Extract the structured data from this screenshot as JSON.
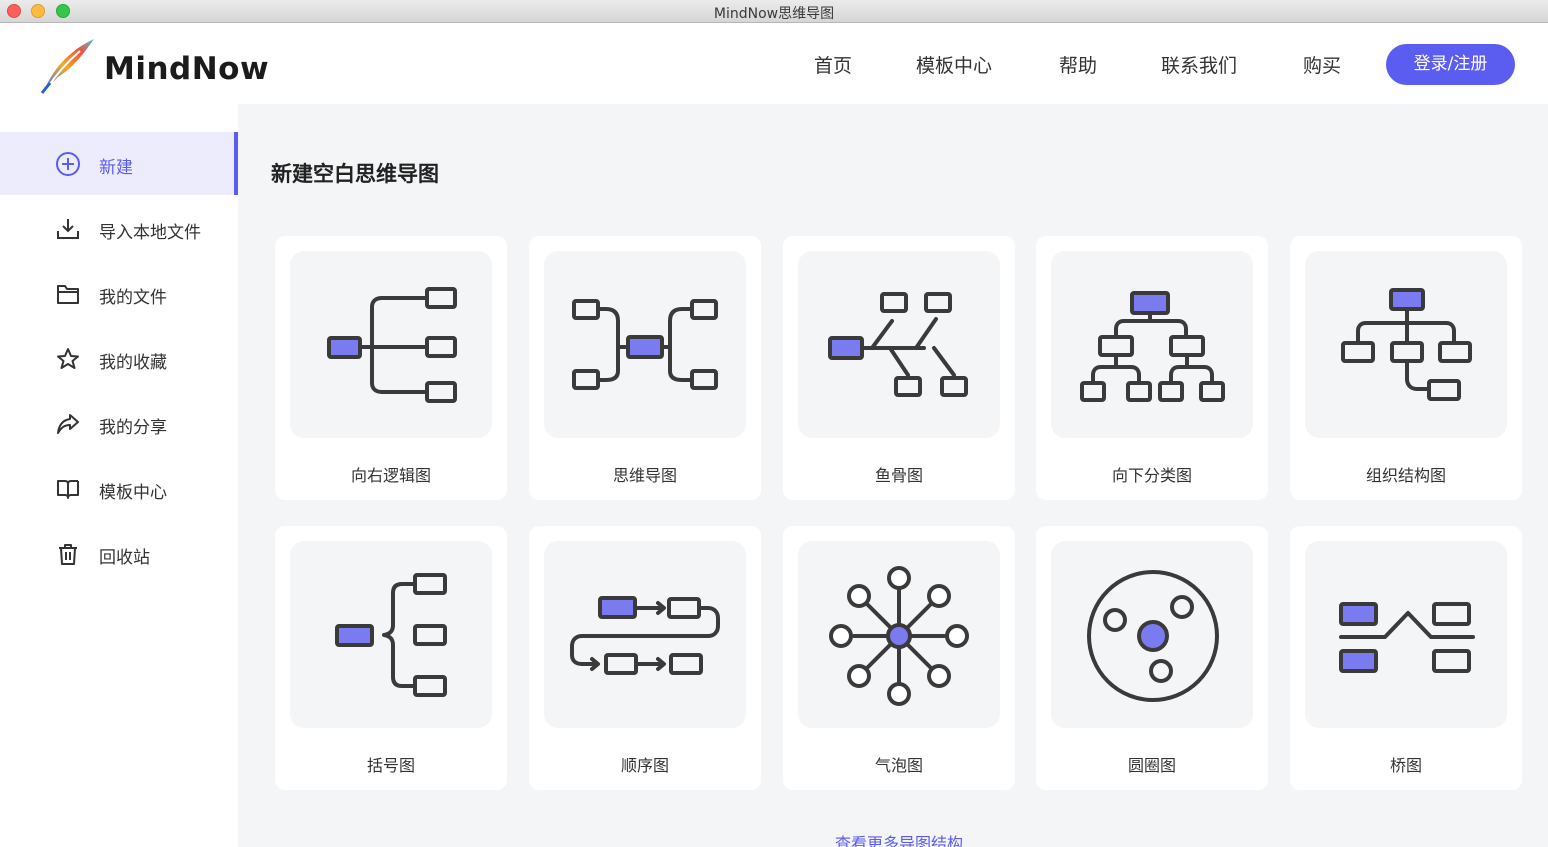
{
  "window": {
    "title": "MindNow思维导图"
  },
  "header": {
    "brand": "MindNow",
    "nav": [
      "首页",
      "模板中心",
      "帮助",
      "联系我们",
      "购买"
    ],
    "login_label": "登录/注册"
  },
  "sidebar": {
    "items": [
      {
        "label": "新建",
        "icon": "plus-circle-icon",
        "active": true
      },
      {
        "label": "导入本地文件",
        "icon": "import-icon"
      },
      {
        "label": "我的文件",
        "icon": "folder-icon"
      },
      {
        "label": "我的收藏",
        "icon": "star-icon"
      },
      {
        "label": "我的分享",
        "icon": "share-icon"
      },
      {
        "label": "模板中心",
        "icon": "book-icon"
      },
      {
        "label": "回收站",
        "icon": "trash-icon"
      }
    ]
  },
  "main": {
    "title": "新建空白思维导图",
    "cards": [
      {
        "label": "向右逻辑图",
        "icon": "logic-right-icon"
      },
      {
        "label": "思维导图",
        "icon": "mindmap-icon"
      },
      {
        "label": "鱼骨图",
        "icon": "fishbone-icon"
      },
      {
        "label": "向下分类图",
        "icon": "tree-down-icon"
      },
      {
        "label": "组织结构图",
        "icon": "org-chart-icon"
      },
      {
        "label": "括号图",
        "icon": "brace-icon"
      },
      {
        "label": "顺序图",
        "icon": "sequence-icon"
      },
      {
        "label": "气泡图",
        "icon": "bubble-icon"
      },
      {
        "label": "圆圈图",
        "icon": "circle-map-icon"
      },
      {
        "label": "桥图",
        "icon": "bridge-icon"
      }
    ],
    "more_label": "查看更多导图结构"
  },
  "colors": {
    "accent": "#5b5cf0",
    "node_fill": "#7b7bf0",
    "stroke": "#3a3a3a",
    "panel": "#f4f5f7"
  }
}
